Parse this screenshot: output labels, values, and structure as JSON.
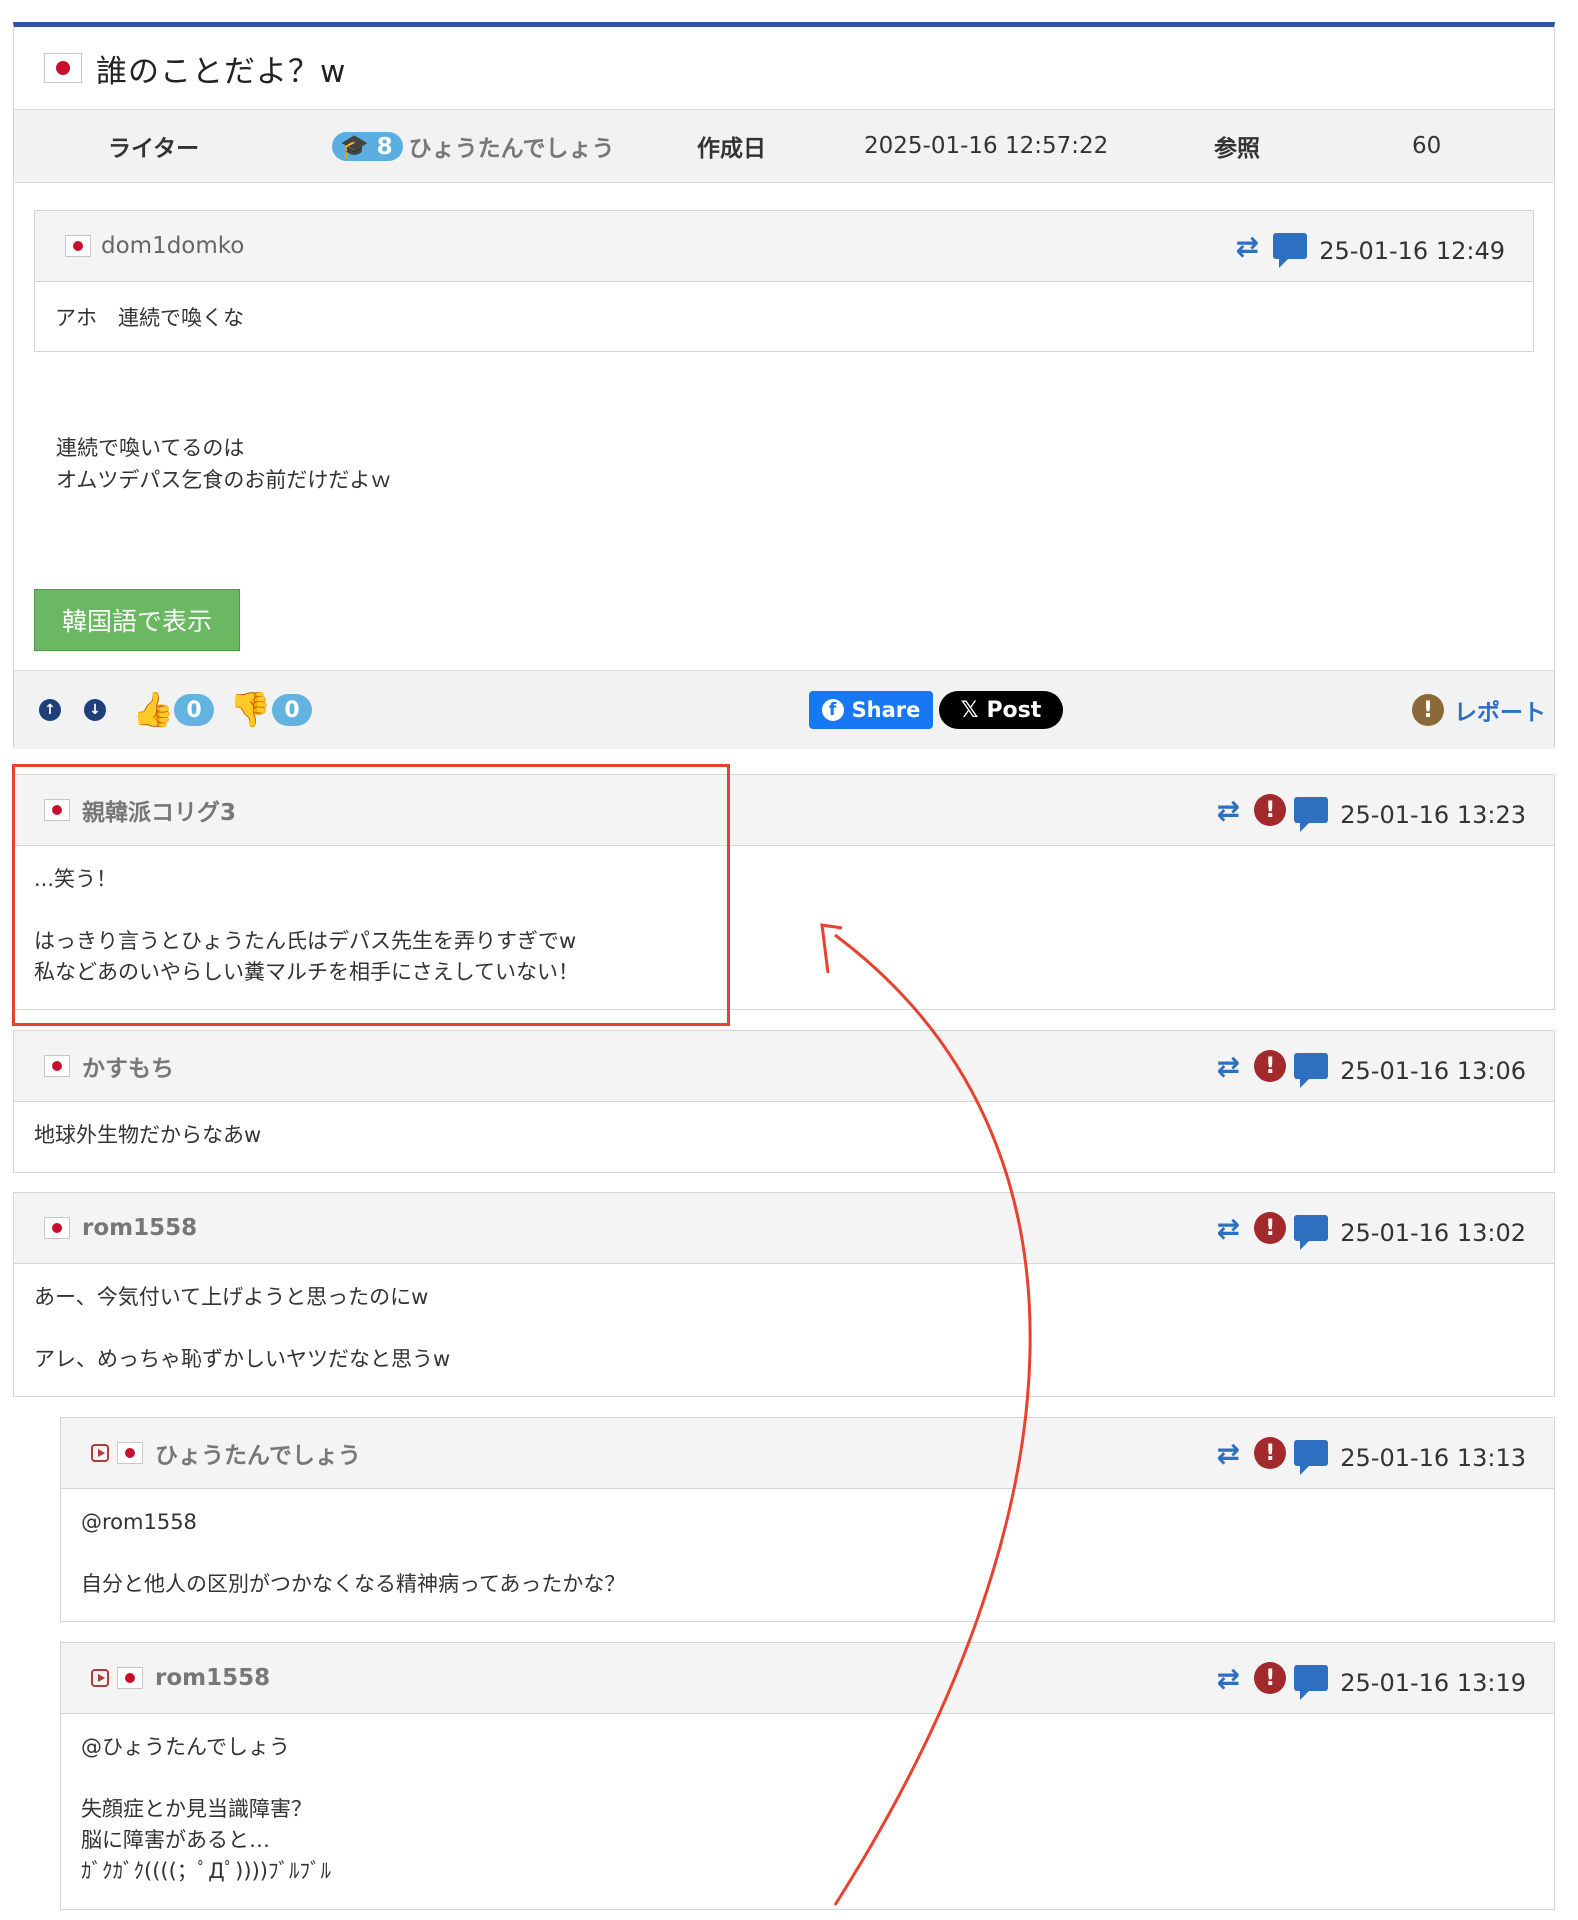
{
  "post": {
    "title": "誰のことだよ？w",
    "meta": {
      "writer_label": "ライター",
      "writer_level": "8",
      "writer_name": "ひょうたんでしょう",
      "created_label": "作成日",
      "created_value": "2025-01-16 12:57:22",
      "views_label": "参照",
      "views_value": "60"
    },
    "quote": {
      "user": "dom1domko",
      "date": "25-01-16 12:49",
      "text": "アホ　連続で喚くな"
    },
    "body_lines": [
      "連続で喚いてるのは",
      "オムツデパス乞食のお前だけだよｗ"
    ],
    "translate_button": "韓国語で表示",
    "likes": "0",
    "dislikes": "0",
    "share_fb": "Share",
    "share_x": "Post",
    "report": "レポート"
  },
  "comments": [
    {
      "user": "親韓派コリグ3",
      "date": "25-01-16 13:23",
      "lines": [
        "...笑う！",
        "",
        "はっきり言うとひょうたん氏はデパス先生を弄りすぎでw",
        "私などあのいやらしい糞マルチを相手にさえしていない！"
      ]
    },
    {
      "user": "かすもち",
      "date": "25-01-16 13:06",
      "lines": [
        "地球外生物だからなあw"
      ]
    },
    {
      "user": "rom1558",
      "date": "25-01-16 13:02",
      "lines": [
        "あー、今気付いて上げようと思ったのにw",
        "",
        "アレ、めっちゃ恥ずかしいヤツだなと思うw"
      ]
    },
    {
      "user": "ひょうたんでしょう",
      "date": "25-01-16 13:13",
      "lines": [
        "@rom1558",
        "",
        "自分と他人の区別がつかなくなる精神病ってあったかな？"
      ]
    },
    {
      "user": "rom1558",
      "date": "25-01-16 13:19",
      "lines": [
        "@ひょうたんでしょう",
        "",
        "失顔症とか見当識障害？",
        "脳に障害があると…",
        "ｶﾞｸｶﾞｸ((((；ﾟДﾟ))))ﾌﾞﾙﾌﾞﾙ"
      ]
    }
  ],
  "colors": {
    "accent_bar": "#2c56a0",
    "annotation_red": "#e8422f",
    "link_blue": "#2f6fc0",
    "report_red": "#a22a2a",
    "translate_green": "#6bb862"
  },
  "icons": {
    "swap": "swap-arrows-icon",
    "report": "report-exclamation-icon",
    "reply": "reply-chat-icon",
    "reply_marker": "reply-play-icon",
    "flag": "japan-flag-icon"
  }
}
